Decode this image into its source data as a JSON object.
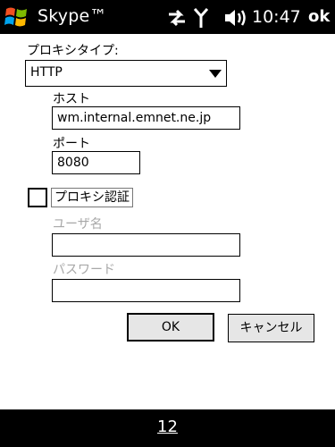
{
  "titlebar": {
    "app_title": "Skype™",
    "clock": "10:47",
    "ok_label": "ok"
  },
  "proxy": {
    "type_label": "プロキシタイプ:",
    "type_value": "HTTP",
    "host_label": "ホスト",
    "host_value": "wm.internal.emnet.ne.jp",
    "port_label": "ポート",
    "port_value": "8080",
    "auth_label": "プロキシ認証",
    "auth_checked": false,
    "username_label": "ユーザ名",
    "username_value": "",
    "password_label": "パスワード",
    "password_value": ""
  },
  "buttons": {
    "ok": "OK",
    "cancel": "キャンセル"
  },
  "softkeys": {
    "center": "12"
  },
  "icons": {
    "start": "windows-logo-icon",
    "sync": "sync-arrows-icon",
    "signal": "signal-antenna-icon",
    "volume": "speaker-volume-icon",
    "dropdown": "dropdown-arrow-icon"
  }
}
